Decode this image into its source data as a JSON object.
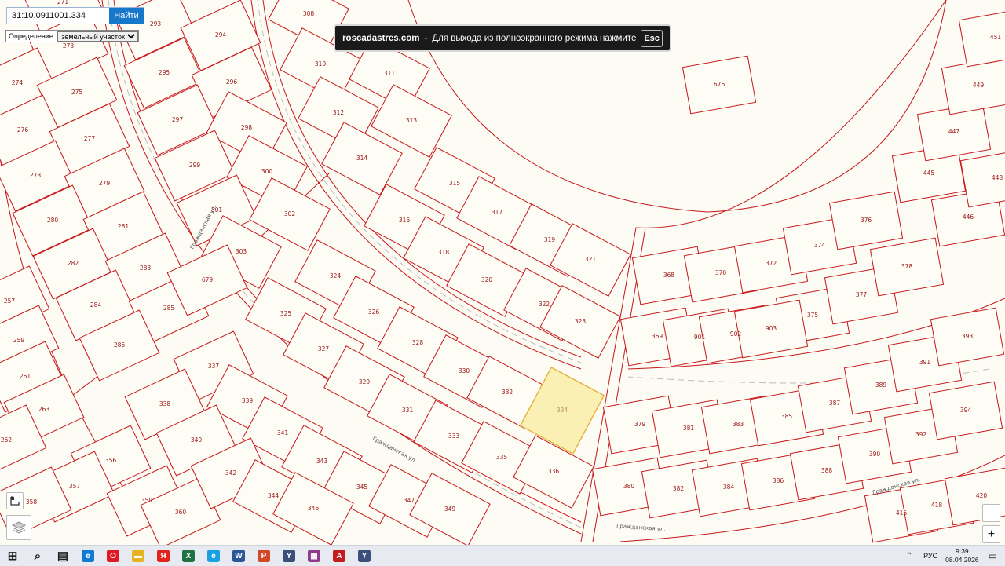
{
  "search": {
    "value": "31:10.0911001.334",
    "button_label": "Найти"
  },
  "definition": {
    "label": "Определение:",
    "selected": "земельный участок"
  },
  "fullscreen_banner": {
    "site": "roscadastres.com",
    "separator": "-",
    "message": "Для выхода из полноэкранного режима нажмите",
    "key": "Esc"
  },
  "map": {
    "selected_parcel": "334",
    "street_name": "Гражданская ул.",
    "parcel_numbers": [
      "271",
      "273",
      "274",
      "275",
      "276",
      "277",
      "278",
      "279",
      "280",
      "281",
      "282",
      "283",
      "284",
      "285",
      "286",
      "257",
      "259",
      "261",
      "263",
      "262",
      "356",
      "357",
      "358",
      "359",
      "360",
      "293",
      "294",
      "295",
      "296",
      "297",
      "298",
      "299",
      "300",
      "301",
      "302",
      "303",
      "679",
      "308",
      "310",
      "311",
      "312",
      "313",
      "314",
      "676",
      "315",
      "316",
      "317",
      "318",
      "319",
      "320",
      "321",
      "322",
      "323",
      "324",
      "325",
      "326",
      "327",
      "328",
      "329",
      "330",
      "331",
      "332",
      "333",
      "334",
      "335",
      "336",
      "337",
      "338",
      "339",
      "340",
      "341",
      "342",
      "343",
      "344",
      "345",
      "346",
      "347",
      "349",
      "368",
      "369",
      "370",
      "372",
      "374",
      "375",
      "376",
      "377",
      "378",
      "379",
      "380",
      "381",
      "382",
      "383",
      "384",
      "385",
      "386",
      "387",
      "388",
      "389",
      "390",
      "391",
      "392",
      "393",
      "394",
      "416",
      "418",
      "420",
      "445",
      "446",
      "447",
      "448",
      "449",
      "451",
      "901",
      "902",
      "903"
    ]
  },
  "taskbar": {
    "apps": [
      {
        "name": "windows-start-icon",
        "glyph": "⊞",
        "color": "#1d1d1d"
      },
      {
        "name": "search-icon",
        "glyph": "⌕",
        "color": "#1d1d1d"
      },
      {
        "name": "task-view-icon",
        "glyph": "▤",
        "color": "#1d1d1d"
      },
      {
        "name": "edge-icon",
        "glyph": "e",
        "color": "#0f7bd4"
      },
      {
        "name": "opera-icon",
        "glyph": "O",
        "color": "#e01927"
      },
      {
        "name": "explorer-icon",
        "glyph": "▬",
        "color": "#e8b323"
      },
      {
        "name": "yandex-icon",
        "glyph": "Я",
        "color": "#e0241b"
      },
      {
        "name": "excel-icon",
        "glyph": "X",
        "color": "#1f7244"
      },
      {
        "name": "ie-icon",
        "glyph": "e",
        "color": "#1aa0e0"
      },
      {
        "name": "word-icon",
        "glyph": "W",
        "color": "#2b5797"
      },
      {
        "name": "powerpoint-icon",
        "glyph": "P",
        "color": "#d24726"
      },
      {
        "name": "yandex-browser-icon",
        "glyph": "Y",
        "color": "#3a4f7a"
      },
      {
        "name": "archive-icon",
        "glyph": "▦",
        "color": "#8d3b8a"
      },
      {
        "name": "acrobat-icon",
        "glyph": "A",
        "color": "#c41d1d"
      },
      {
        "name": "yandex-browser-2-icon",
        "glyph": "Y",
        "color": "#3a4f7a"
      }
    ],
    "language": "РУС",
    "time": "9:39",
    "date": "08.04.2026"
  }
}
